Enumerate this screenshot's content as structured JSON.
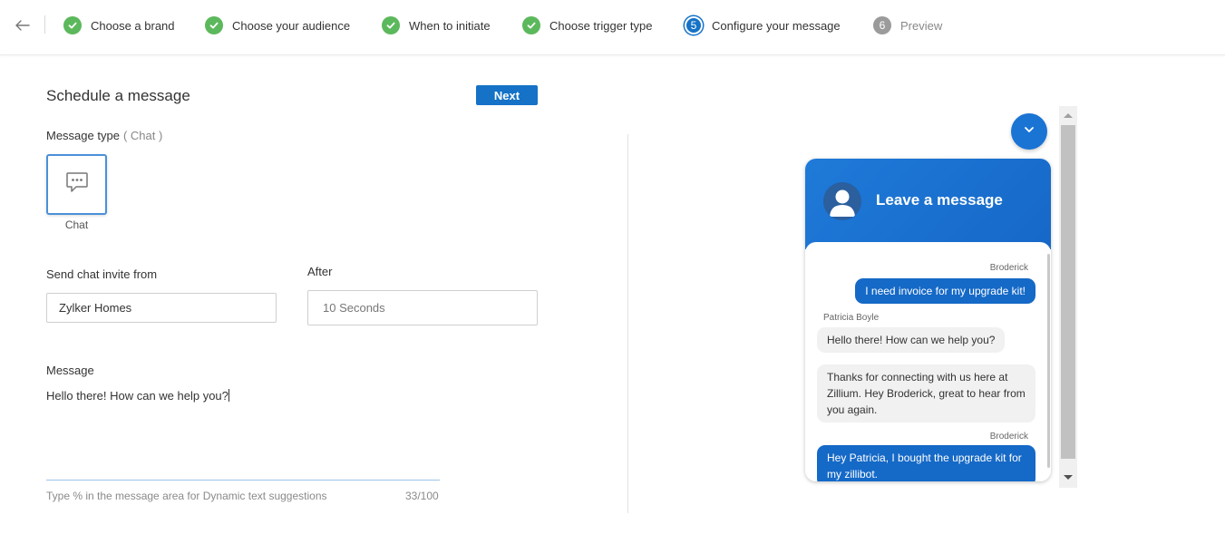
{
  "stepper": {
    "steps": [
      {
        "label": "Choose a brand",
        "status": "done"
      },
      {
        "label": "Choose your audience",
        "status": "done"
      },
      {
        "label": "When to initiate",
        "status": "done"
      },
      {
        "label": "Choose trigger type",
        "status": "done"
      },
      {
        "label": "Configure your message",
        "status": "active",
        "number": "5"
      },
      {
        "label": "Preview",
        "status": "pending",
        "number": "6"
      }
    ]
  },
  "form": {
    "title": "Schedule a message",
    "next_label": "Next",
    "message_type_label": "Message type",
    "message_type_value": "( Chat )",
    "type_card_label": "Chat",
    "invite_from_label": "Send chat invite from",
    "invite_from_value": "Zylker Homes",
    "after_label": "After",
    "after_value": "10 Seconds",
    "message_label": "Message",
    "message_value": "Hello there! How can we help you?",
    "hint": "Type % in the message area for Dynamic text suggestions",
    "counter": "33/100"
  },
  "preview": {
    "header_title": "Leave a message",
    "messages": [
      {
        "sender": "Broderick",
        "text": "I need invoice for my upgrade kit!",
        "direction": "out"
      },
      {
        "sender": "Patricia Boyle",
        "text": "Hello there! How can we help you?",
        "direction": "in"
      },
      {
        "sender": "",
        "text": "Thanks for connecting with us here at Zillium. Hey Broderick, great to hear from you again.",
        "direction": "in"
      },
      {
        "sender": "Broderick",
        "text": "Hey Patricia, I bought the upgrade kit for my zillibot.",
        "direction": "out"
      }
    ]
  },
  "colors": {
    "accent": "#1572c6",
    "done": "#5cb85c",
    "pending": "#9b9b9b"
  },
  "icons": {
    "back": "arrow-left-icon",
    "done": "check-icon",
    "chat_type": "chat-bubble-icon",
    "minimize": "chevron-down-icon"
  }
}
